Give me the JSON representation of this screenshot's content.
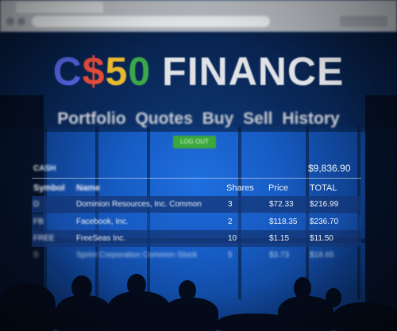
{
  "logo": {
    "c": "C",
    "dollar": "$",
    "five": "5",
    "zero": "0",
    "finance": "FINANCE"
  },
  "nav": [
    "Portfolio",
    "Quotes",
    "Buy",
    "Sell",
    "History"
  ],
  "logout_label": "LOG OUT",
  "cash": {
    "label": "CASH",
    "value": "$9,836.90"
  },
  "table": {
    "headers": {
      "symbol": "Symbol",
      "name": "Name",
      "shares": "Shares",
      "price": "Price",
      "total": "TOTAL"
    },
    "rows": [
      {
        "symbol": "D",
        "name": "Dominion Resources, Inc. Common",
        "shares": "3",
        "price": "$72.33",
        "total": "$216.99"
      },
      {
        "symbol": "FB",
        "name": "Facebook, Inc.",
        "shares": "2",
        "price": "$118.35",
        "total": "$236.70"
      },
      {
        "symbol": "FREE",
        "name": "FreeSeas Inc.",
        "shares": "10",
        "price": "$1.15",
        "total": "$11.50"
      },
      {
        "symbol": "S",
        "name": "Sprint Corporation Common Stock",
        "shares": "5",
        "price": "$3.73",
        "total": "$18.65"
      }
    ]
  },
  "colors": {
    "logo_c": "#4f5fd8",
    "logo_dollar": "#e34b3a",
    "logo_five": "#e8b92e",
    "logo_zero": "#3ca84a",
    "logout_button": "#3aa83a",
    "background": "#1f6fe0"
  }
}
